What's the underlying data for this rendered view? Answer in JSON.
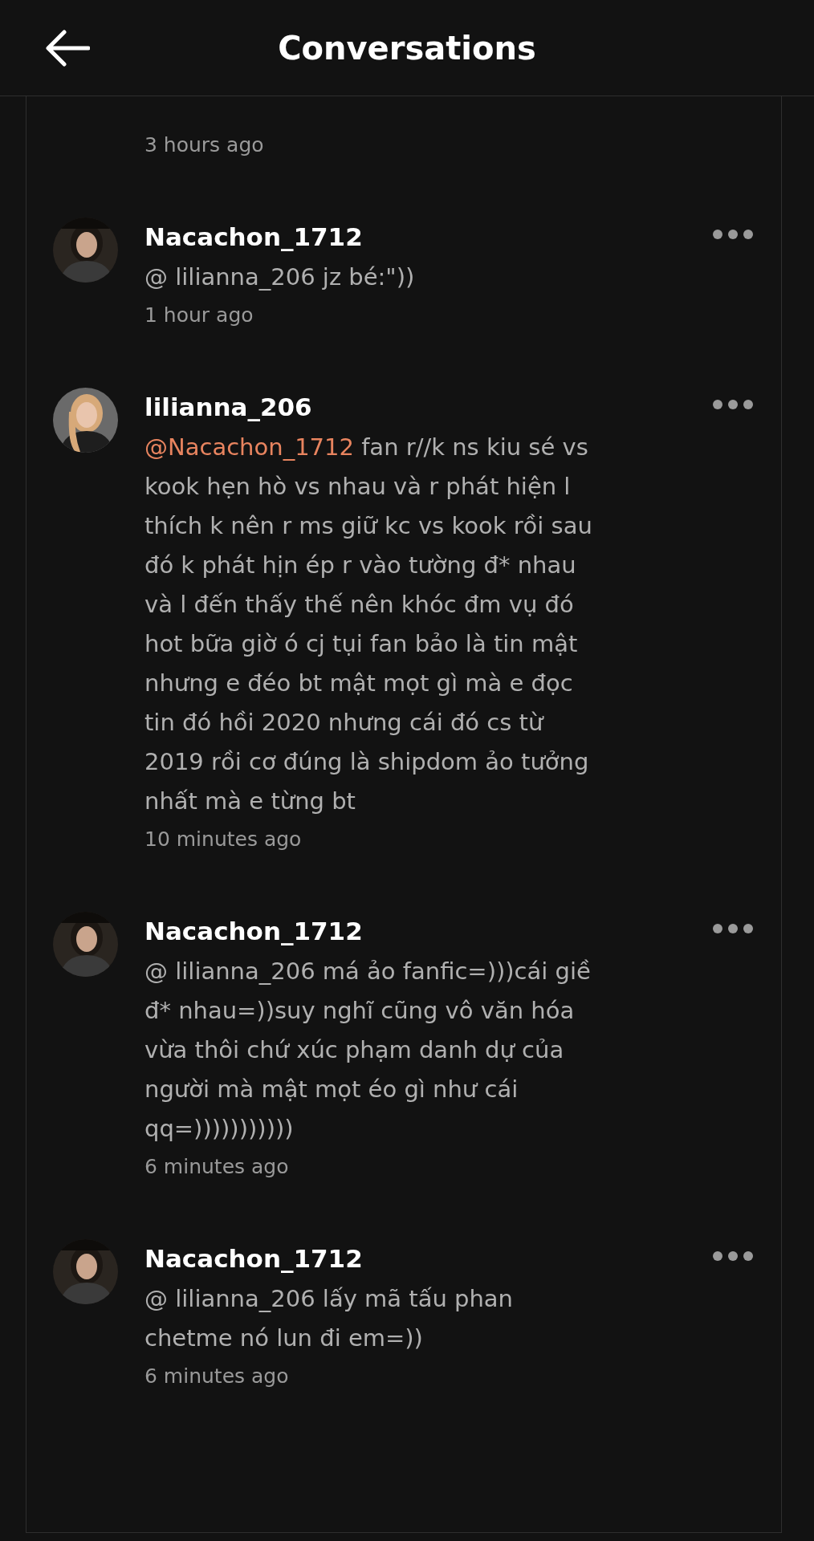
{
  "header": {
    "title": "Conversations"
  },
  "comments": [
    {
      "time": "3 hours ago"
    },
    {
      "author": "Nacachon_1712",
      "text": "@ lilianna_206  jz bé:\"))",
      "time": "1 hour ago"
    },
    {
      "author": "lilianna_206",
      "mention": "@Nacachon_1712",
      "text": "fan r//k  ns kiu sé vs kook hẹn hò vs nhau và r phát hiện l thích k nên r ms giữ kc vs kook rồi sau đó k phát hịn ép r vào tường đ* nhau  và l đến thấy thế nên khóc đm vụ đó hot bữa giờ ó cj tụi fan bảo là tin mật nhưng e đéo bt mật mọt gì mà e đọc tin đó hồi 2020 nhưng cái đó cs từ 2019 rồi cơ đúng là shipdom ảo tưởng nhất mà e từng bt",
      "time": "10 minutes ago"
    },
    {
      "author": "Nacachon_1712",
      "text": "@ lilianna_206  má ảo fanfic=)))cái giề đ* nhau=))suy nghĩ cũng vô văn hóa vừa thôi chứ xúc phạm danh dự của người mà mật mọt éo gì như cái qq=)))))))))))",
      "time": "6 minutes ago"
    },
    {
      "author": "Nacachon_1712",
      "text": "@ lilianna_206  lấy mã tấu phan chetme nó lun đi em=))",
      "time": "6 minutes ago"
    }
  ]
}
